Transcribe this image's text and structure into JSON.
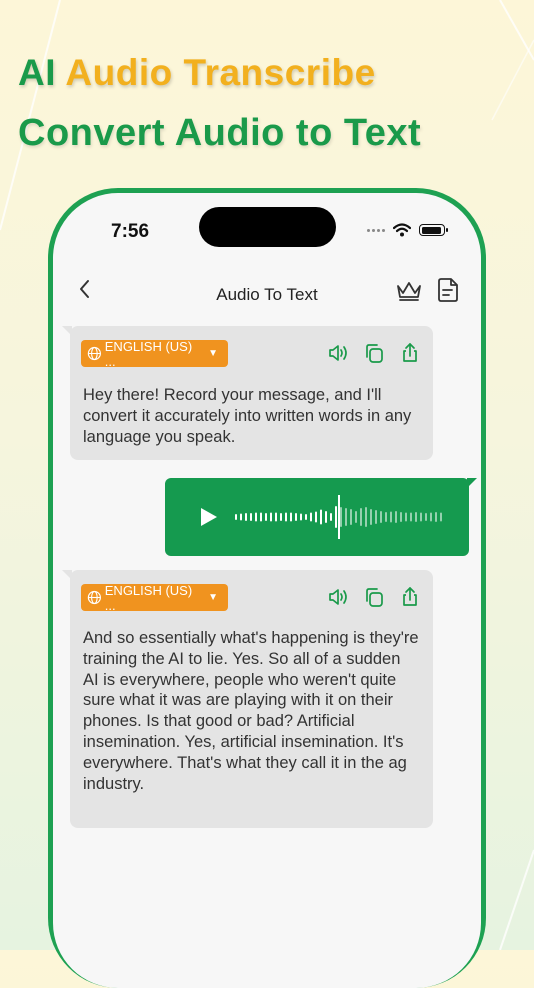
{
  "promo": {
    "title_ai": "AI",
    "title_rest": "Audio Transcribe",
    "subtitle": "Convert Audio to Text"
  },
  "status_bar": {
    "time": "7:56"
  },
  "nav": {
    "title": "Audio To Text"
  },
  "messages": [
    {
      "language": "ENGLISH (US) ...",
      "text": "Hey there! Record your message, and I'll convert it accurately into written words in any language you speak."
    },
    {
      "language": "ENGLISH (US) ...",
      "text": "And so essentially what's happening is they're training the AI to lie. Yes. So all of a sudden AI is everywhere, people who weren't quite sure what it was are playing with it on their phones. Is that good or bad? Artificial insemination. Yes, artificial insemination. It's everywhere. That's what they call it in the ag industry."
    }
  ],
  "audio_message": {
    "played_fraction": 0.5
  },
  "colors": {
    "brand_green": "#1a9a4a",
    "accent_orange": "#f0931f",
    "title_yellow": "#f2b01e"
  },
  "icons": [
    "chevron-left-icon",
    "crown-icon",
    "document-icon",
    "speaker-icon",
    "copy-icon",
    "share-icon",
    "globe-icon",
    "play-icon",
    "wifi-icon",
    "battery-icon"
  ]
}
